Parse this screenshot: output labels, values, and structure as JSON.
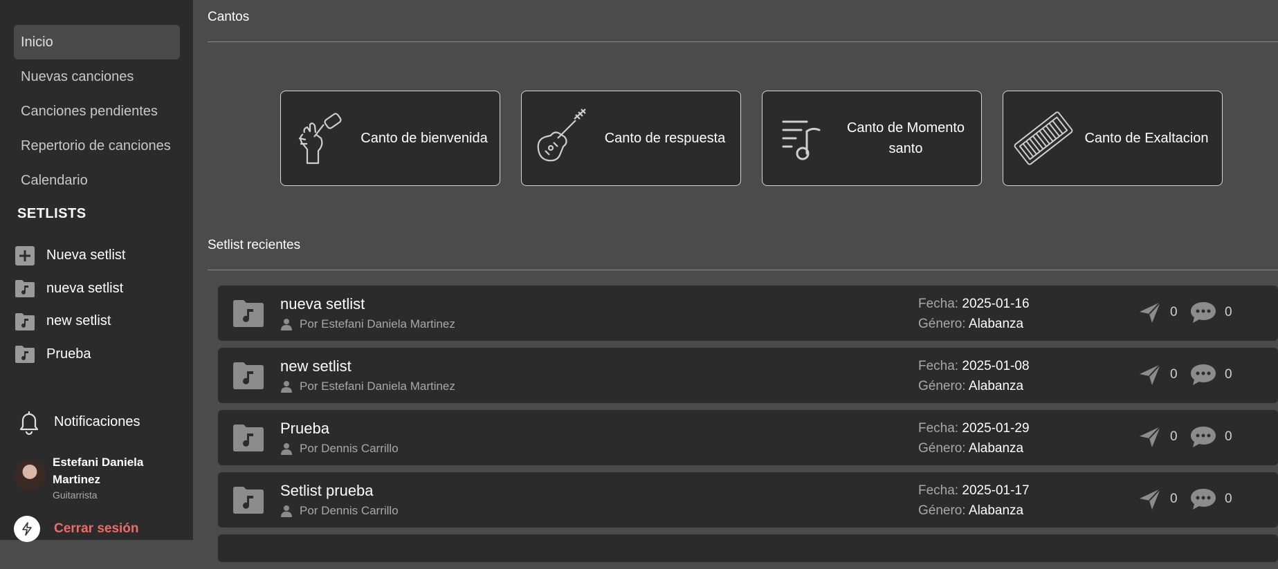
{
  "nav": {
    "items": [
      {
        "label": "Inicio",
        "active": true
      },
      {
        "label": "Nuevas canciones"
      },
      {
        "label": "Canciones pendientes"
      },
      {
        "label": "Repertorio de canciones"
      },
      {
        "label": "Calendario"
      }
    ]
  },
  "setlists": {
    "title": "SETLISTS",
    "new_label": "Nueva setlist",
    "items": [
      {
        "label": "nueva setlist"
      },
      {
        "label": "new setlist"
      },
      {
        "label": "Prueba"
      }
    ]
  },
  "notifications": {
    "label": "Notificaciones",
    "icon": "bell-icon"
  },
  "user": {
    "name": "Estefani Daniela Martinez",
    "role": "Guitarrista"
  },
  "logout": {
    "label": "Cerrar sesión",
    "icon": "lightning-icon",
    "color": "#f06a6a"
  },
  "cantos": {
    "title": "Cantos",
    "cards": [
      {
        "label": "Canto de bienvenida",
        "icon": "microphone-hand-icon"
      },
      {
        "label": "Canto de respuesta",
        "icon": "electric-guitar-icon"
      },
      {
        "label": "Canto de Momento santo",
        "icon": "music-lines-note-icon"
      },
      {
        "label": "Canto de Exaltacion",
        "icon": "keyboard-icon"
      }
    ]
  },
  "recent": {
    "title": "Setlist recientes",
    "fecha_label": "Fecha:",
    "genero_label": "Género:",
    "rows": [
      {
        "title": "nueva setlist",
        "author": "Por Estefani Daniela Martinez",
        "fecha": "2025-01-16",
        "genero": "Alabanza",
        "shares": "0",
        "comments": "0"
      },
      {
        "title": "new setlist",
        "author": "Por Estefani Daniela Martinez",
        "fecha": "2025-01-08",
        "genero": "Alabanza",
        "shares": "0",
        "comments": "0"
      },
      {
        "title": "Prueba",
        "author": "Por Dennis Carrillo",
        "fecha": "2025-01-29",
        "genero": "Alabanza",
        "shares": "0",
        "comments": "0"
      },
      {
        "title": "Setlist prueba",
        "author": "Por Dennis Carrillo",
        "fecha": "2025-01-17",
        "genero": "Alabanza",
        "shares": "0",
        "comments": "0"
      }
    ]
  }
}
